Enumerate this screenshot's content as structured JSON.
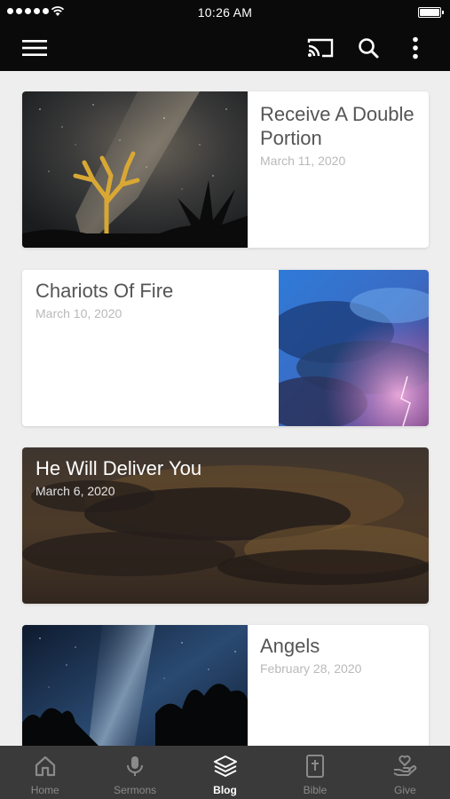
{
  "status_bar": {
    "time": "10:26 AM"
  },
  "app_bar": {
    "icons": [
      "menu-icon",
      "cast-icon",
      "search-icon",
      "more-vertical-icon"
    ]
  },
  "posts": [
    {
      "title": "Receive A Double Portion",
      "date": "March 11, 2020",
      "image": "desert-night-sky-joshua-tree"
    },
    {
      "title": "Chariots Of Fire",
      "date": "March 10, 2020",
      "image": "stormy-clouds-lightning"
    },
    {
      "title": "He Will Deliver You",
      "date": "March 6, 2020",
      "image": "dark-clouds-sunset"
    },
    {
      "title": "Angels",
      "date": "February 28, 2020",
      "image": "milky-way-forest"
    }
  ],
  "bottom_nav": {
    "items": [
      {
        "label": "Home",
        "icon": "home-icon",
        "active": false
      },
      {
        "label": "Sermons",
        "icon": "microphone-icon",
        "active": false
      },
      {
        "label": "Blog",
        "icon": "layers-icon",
        "active": true
      },
      {
        "label": "Bible",
        "icon": "bible-icon",
        "active": false
      },
      {
        "label": "Give",
        "icon": "give-hand-heart-icon",
        "active": false
      }
    ]
  },
  "colors": {
    "bar_background": "#0a0a0a",
    "page_background": "#eeeeee",
    "nav_background": "#3a3a3a",
    "title_text": "#555555",
    "date_text": "#b9b9b9",
    "nav_inactive": "#8a8a8a",
    "nav_active": "#ffffff"
  }
}
